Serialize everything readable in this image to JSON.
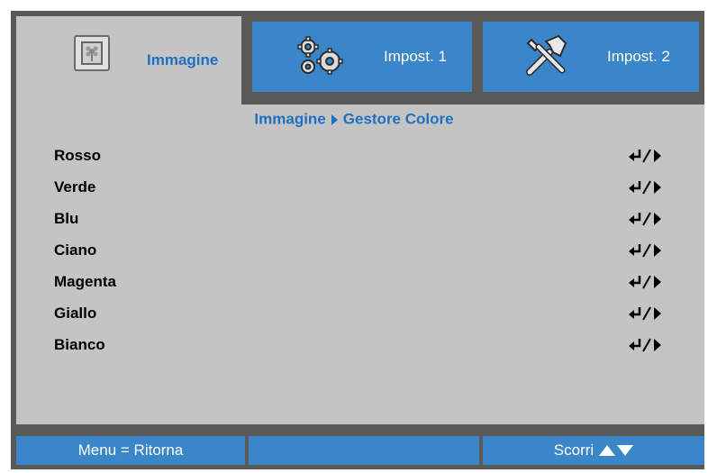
{
  "tabs": [
    {
      "label": "Immagine",
      "icon": "picture-icon",
      "active": true
    },
    {
      "label": "Impost. 1",
      "icon": "gears-icon",
      "active": false
    },
    {
      "label": "Impost. 2",
      "icon": "tools-icon",
      "active": false
    }
  ],
  "breadcrumb": {
    "parent": "Immagine",
    "current": "Gestore Colore"
  },
  "items": [
    {
      "label": "Rosso"
    },
    {
      "label": "Verde"
    },
    {
      "label": "Blu"
    },
    {
      "label": "Ciano"
    },
    {
      "label": "Magenta"
    },
    {
      "label": "Giallo"
    },
    {
      "label": "Bianco"
    }
  ],
  "footer": {
    "back": "Menu = Ritorna",
    "middle": "",
    "scroll": "Scorri"
  },
  "colors": {
    "tab_blue": "#3a86c8",
    "panel_gray": "#c4c4c4",
    "frame_dark": "#5a5a5a",
    "accent_text": "#1f6fc2"
  }
}
